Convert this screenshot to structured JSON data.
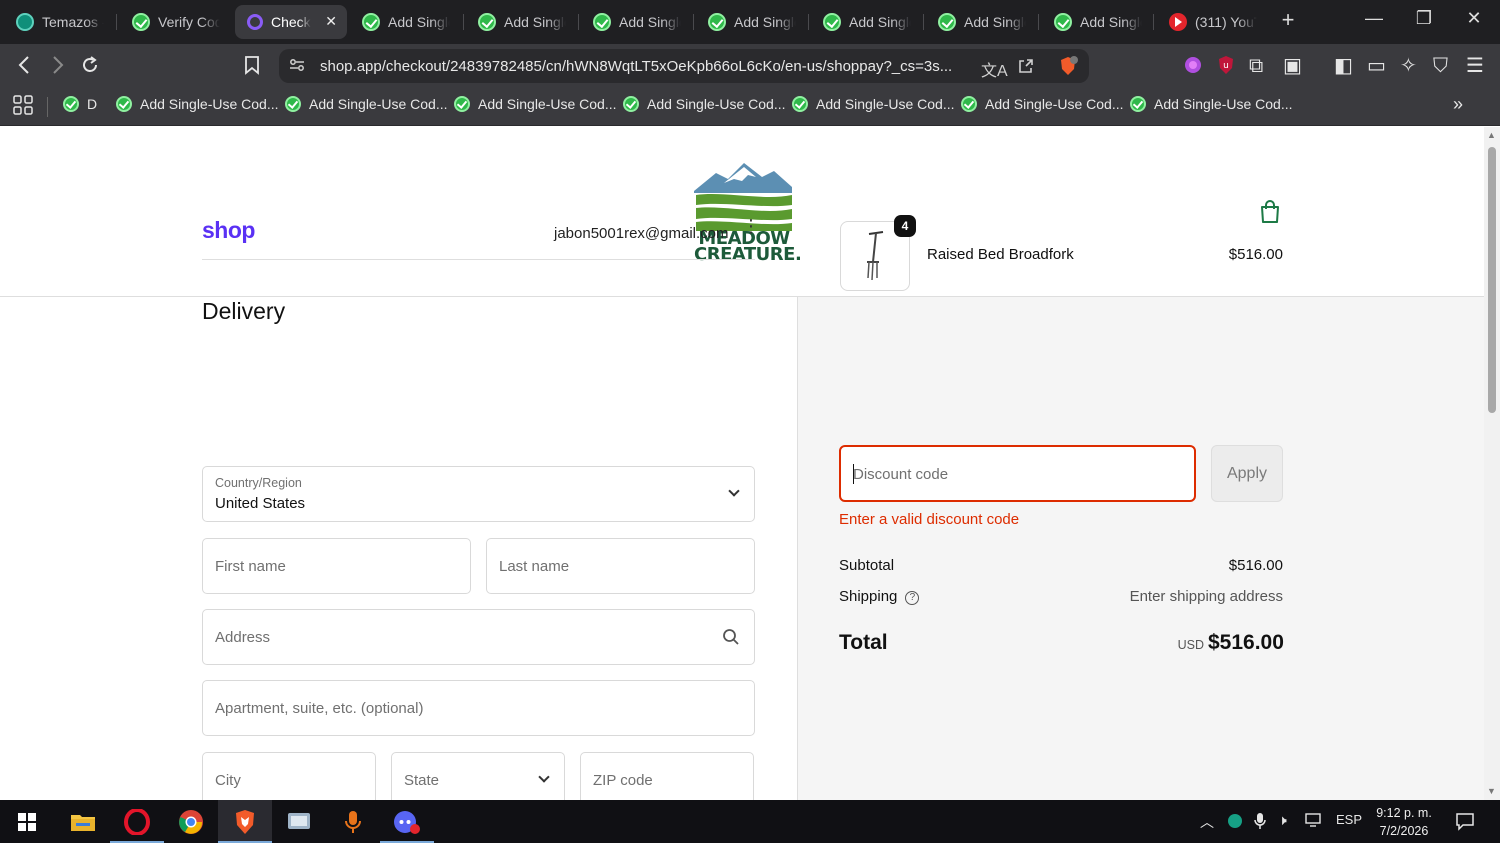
{
  "browser": {
    "tabs": [
      {
        "label": "Temazos -",
        "icon": "teal-circle-icon",
        "active": false
      },
      {
        "label": "Verify Cod",
        "icon": "green-check-icon",
        "active": false
      },
      {
        "label": "Check",
        "icon": "purple-ring-icon",
        "active": true
      },
      {
        "label": "Add Single",
        "icon": "green-check-icon",
        "active": false
      },
      {
        "label": "Add Single",
        "icon": "green-check-icon",
        "active": false
      },
      {
        "label": "Add Single",
        "icon": "green-check-icon",
        "active": false
      },
      {
        "label": "Add Single",
        "icon": "green-check-icon",
        "active": false
      },
      {
        "label": "Add Single",
        "icon": "green-check-icon",
        "active": false
      },
      {
        "label": "Add Single",
        "icon": "green-check-icon",
        "active": false
      },
      {
        "label": "Add Single",
        "icon": "green-check-icon",
        "active": false
      },
      {
        "label": "(311) YouT",
        "icon": "youtube-icon",
        "active": false
      }
    ],
    "url": "shop.app/checkout/24839782485/cn/hWN8WqtLT5xOeKpb66oL6cKo/en-us/shoppay?_cs=3s...",
    "shield_badge": "4",
    "bookmarks": [
      {
        "label": "D"
      },
      {
        "label": "Add Single-Use Cod..."
      },
      {
        "label": "Add Single-Use Cod..."
      },
      {
        "label": "Add Single-Use Cod..."
      },
      {
        "label": "Add Single-Use Cod..."
      },
      {
        "label": "Add Single-Use Cod..."
      },
      {
        "label": "Add Single-Use Cod..."
      },
      {
        "label": "Add Single-Use Cod..."
      }
    ]
  },
  "store": {
    "logo_line1": "MEADOW",
    "logo_line2": "CREATURE.",
    "brand_colors": {
      "mountain": "#5c8fb3",
      "green": "#5a9a2f",
      "dark_green": "#1d5a3a"
    }
  },
  "checkout": {
    "shop_logo": "shop",
    "email": "jabon5001rex@gmail.com",
    "delivery_title": "Delivery",
    "country_label": "Country/Region",
    "country_value": "United States",
    "first_name_placeholder": "First name",
    "last_name_placeholder": "Last name",
    "address_placeholder": "Address",
    "apartment_placeholder": "Apartment, suite, etc. (optional)",
    "city_placeholder": "City",
    "state_placeholder": "State",
    "zip_placeholder": "ZIP code"
  },
  "summary": {
    "item": {
      "name": "Raised Bed Broadfork",
      "price": "$516.00",
      "quantity": "4"
    },
    "discount_placeholder": "Discount code",
    "apply_label": "Apply",
    "discount_error": "Enter a valid discount code",
    "subtotal_label": "Subtotal",
    "subtotal_value": "$516.00",
    "shipping_label": "Shipping",
    "shipping_value": "Enter shipping address",
    "total_label": "Total",
    "currency": "USD",
    "total_value": "$516.00",
    "error_color": "#dd2c00",
    "accent_color": "#5a31f4"
  },
  "taskbar": {
    "language": "ESP",
    "time": "9:12 p. m.",
    "date": "7/2/2026"
  }
}
